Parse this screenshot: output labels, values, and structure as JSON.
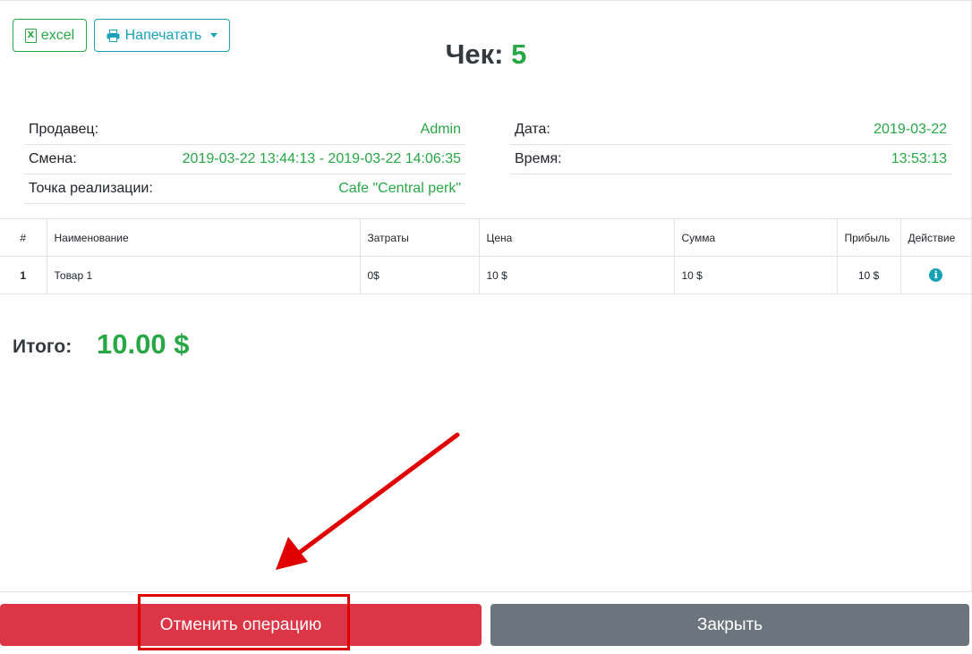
{
  "toolbar": {
    "excel_label": "excel",
    "excel_icon": "X",
    "print_label": "Напечатать"
  },
  "receipt": {
    "title_prefix": "Чек:",
    "number": "5"
  },
  "info_left": [
    {
      "label": "Продавец:",
      "value": "Admin"
    },
    {
      "label": "Смена:",
      "value": "2019-03-22 13:44:13 - 2019-03-22 14:06:35"
    },
    {
      "label": "Точка реализации:",
      "value": "Cafe \"Central perk\""
    }
  ],
  "info_right": [
    {
      "label": "Дата:",
      "value": "2019-03-22"
    },
    {
      "label": "Время:",
      "value": "13:53:13"
    }
  ],
  "table": {
    "headers": [
      "#",
      "Наименование",
      "Затраты",
      "Цена",
      "Сумма",
      "Прибыль",
      "Действие"
    ],
    "rows": [
      {
        "num": "1",
        "name": "Товар 1",
        "cost": "0$",
        "price": "10 $",
        "sum": "10 $",
        "profit": "10 $"
      }
    ]
  },
  "total": {
    "label": "Итого:",
    "value": "10.00 $"
  },
  "footer": {
    "cancel_label": "Отменить операцию",
    "close_label": "Закрыть"
  },
  "colors": {
    "green": "#28a745",
    "info": "#17a2b8",
    "danger": "#dc3545",
    "secondary": "#6c757d",
    "annotation": "#e00000"
  }
}
